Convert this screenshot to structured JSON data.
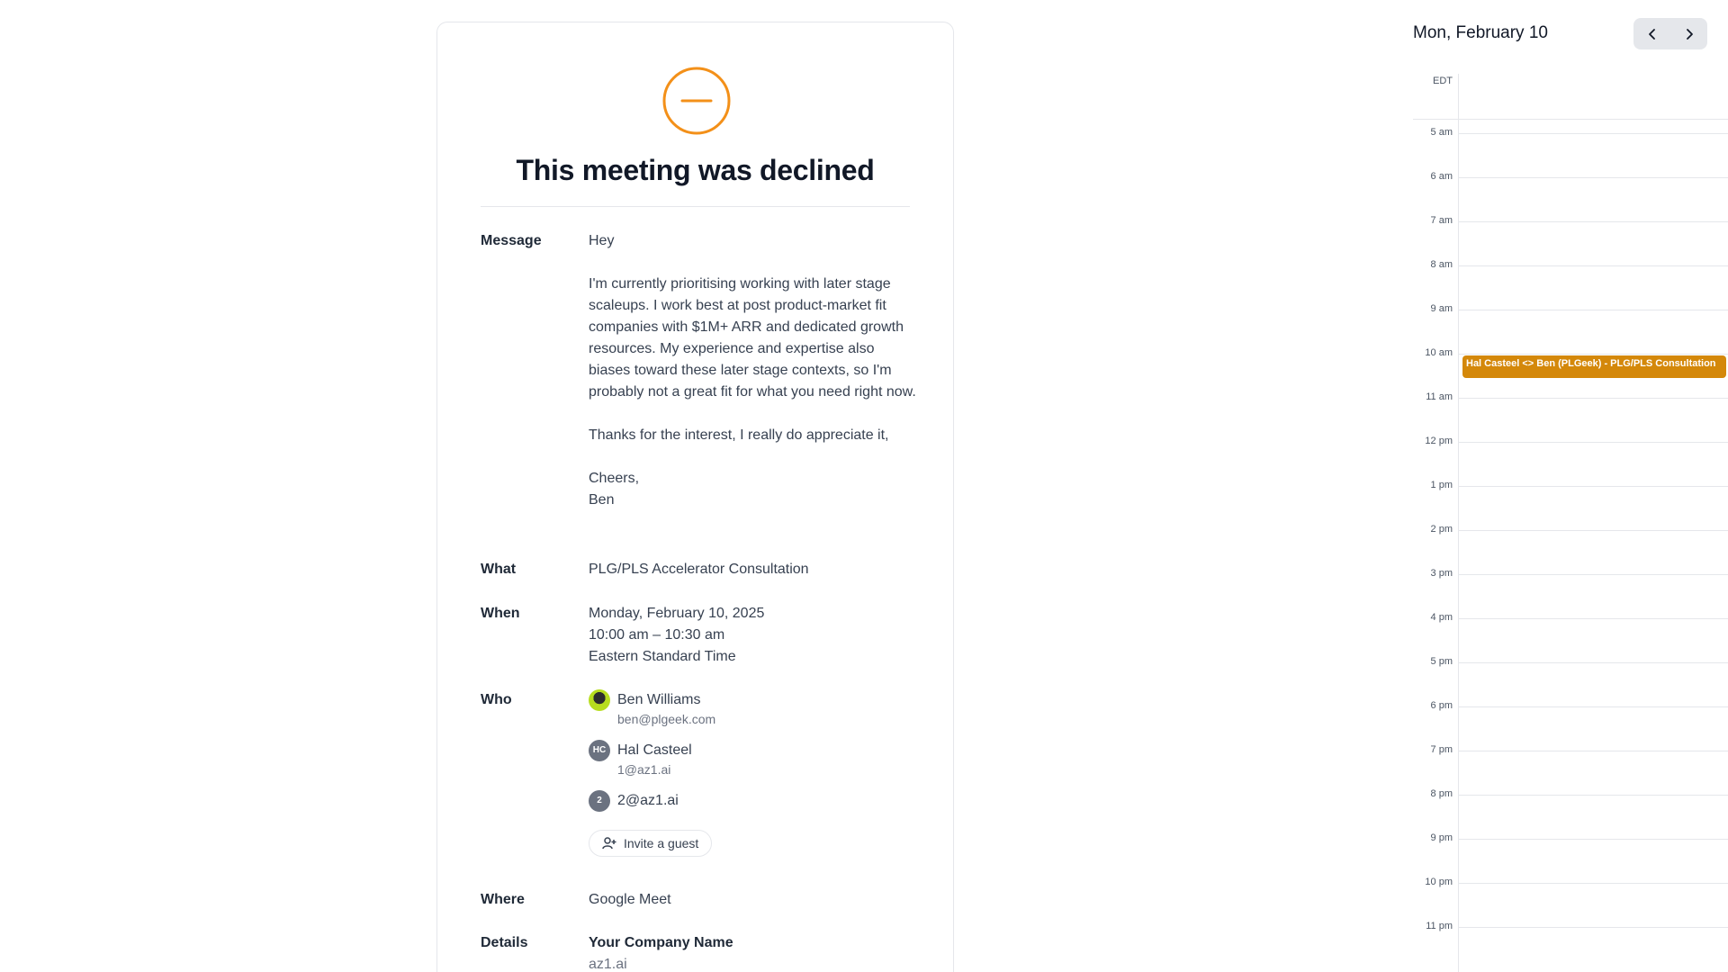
{
  "booking": {
    "title": "This meeting was declined",
    "status_color": "#f39019",
    "message": {
      "label": "Message",
      "paragraphs": [
        "Hey",
        "I'm currently prioritising working with later stage scaleups. I work best at post product-market fit companies with $1M+ ARR and dedicated growth resources. My experience and expertise also biases toward these later stage contexts, so I'm probably not a great fit for what you need right now.",
        "Thanks for the interest, I really do appreciate it,"
      ],
      "signoff_1": "Cheers,",
      "signoff_2": "Ben"
    },
    "what": {
      "label": "What",
      "value": "PLG/PLS Accelerator Consultation"
    },
    "when": {
      "label": "When",
      "date": "Monday, February 10, 2025",
      "time": "10:00 am – 10:30 am",
      "timezone": "Eastern Standard Time"
    },
    "who": {
      "label": "Who",
      "people": [
        {
          "name": "Ben Williams",
          "email": "ben@plgeek.com",
          "avatar": "photo"
        },
        {
          "name": "Hal Casteel",
          "email": "1@az1.ai",
          "avatar_initials": "HC"
        },
        {
          "name": "2@az1.ai",
          "avatar_initials": "2"
        }
      ],
      "invite_label": "Invite a guest"
    },
    "where": {
      "label": "Where",
      "value": "Google Meet"
    },
    "details": {
      "label": "Details",
      "company_name": "Your Company Name",
      "company_url": "az1.ai"
    }
  },
  "calendar": {
    "date_label": "Mon, February 10",
    "timezone": "EDT",
    "hours": [
      "5 am",
      "6 am",
      "7 am",
      "8 am",
      "9 am",
      "10 am",
      "11 am",
      "12 pm",
      "1 pm",
      "2 pm",
      "3 pm",
      "4 pm",
      "5 pm",
      "6 pm",
      "7 pm",
      "8 pm",
      "9 pm",
      "10 pm",
      "11 pm"
    ],
    "event": {
      "title": "Hal Casteel <> Ben (PLGeek) - PLG/PLS Consultation",
      "color": "#d4880a"
    }
  }
}
